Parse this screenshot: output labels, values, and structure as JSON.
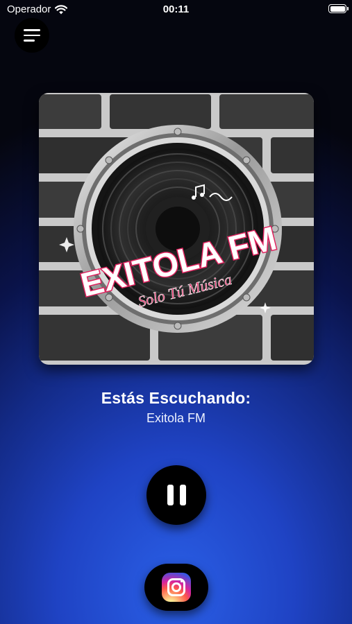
{
  "status_bar": {
    "carrier": "Operador",
    "time": "00:11",
    "battery_level": 1.0
  },
  "menu": {
    "icon": "hamburger-menu-icon"
  },
  "artwork": {
    "logo_title": "EXITOLA FM",
    "logo_subtitle": "Solo Tú Música",
    "colors": {
      "title": "#ffffff",
      "accent": "#e0235f"
    }
  },
  "now_playing": {
    "heading": "Estás Escuchando:",
    "station": "Exitola FM"
  },
  "player": {
    "state": "playing",
    "control_icon": "pause-icon"
  },
  "social": {
    "icon": "instagram-icon"
  }
}
